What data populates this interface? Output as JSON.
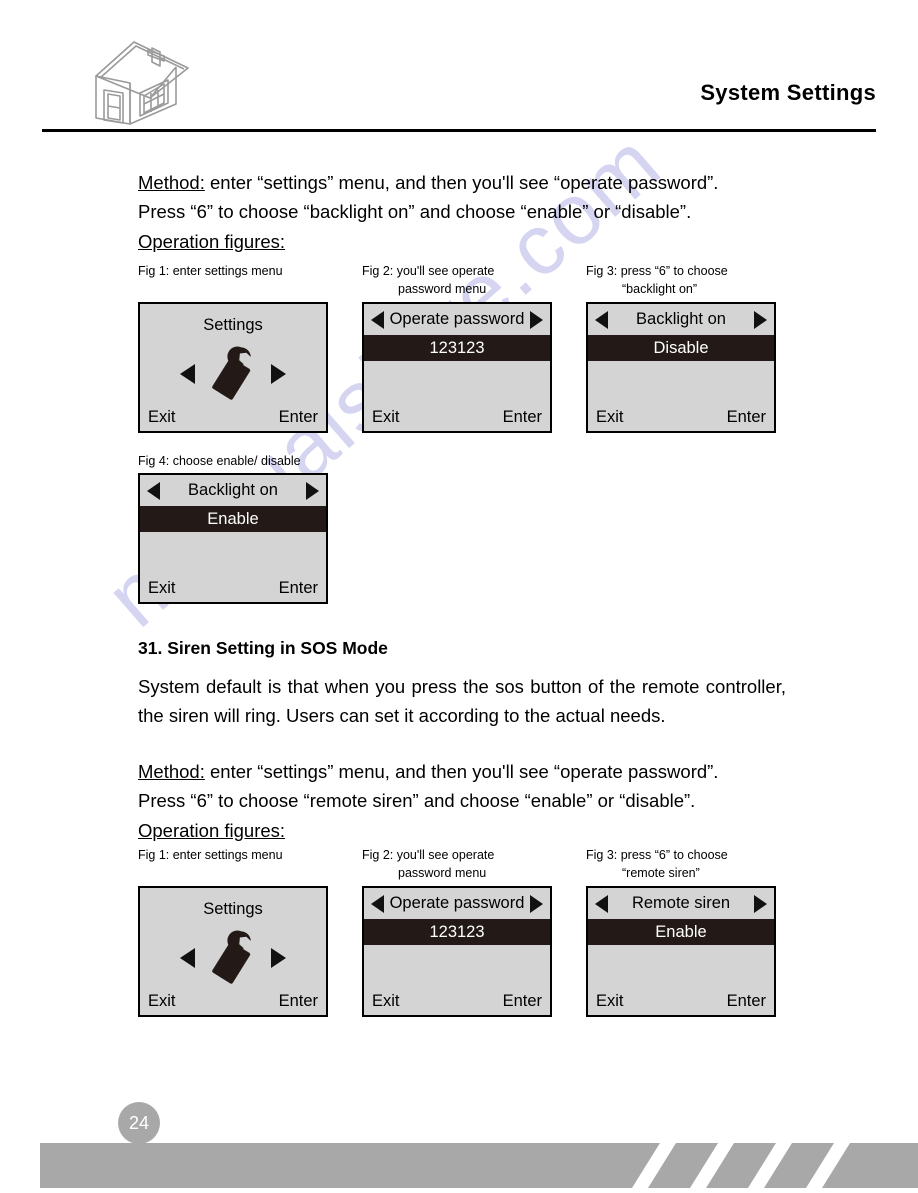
{
  "header": {
    "title": "System Settings",
    "logo_icon": "house-icon"
  },
  "watermark": {
    "text": "manualshive.com",
    "color": "#d5d5f2"
  },
  "sections": [
    {
      "method_line1_label": "Method:",
      "method_line1_rest": " enter “settings” menu, and then you'll see “operate password”.",
      "method_line2": "Press “6” to choose “backlight on” and choose “enable” or “disable”.",
      "operation_figures_label": "Operation figures:"
    },
    {
      "heading": "31. Siren Setting in SOS Mode",
      "body": "System default is that when you press the sos button of the remote controller, the siren will ring. Users can set it according to the actual needs.",
      "method_line1_label": "Method:",
      "method_line1_rest": " enter “settings” menu, and then you'll see “operate password”.",
      "method_line2": "Press “6” to choose “remote siren” and choose “enable” or “disable”.",
      "operation_figures_label": "Operation figures:"
    }
  ],
  "figures_group1": {
    "fig1": {
      "caption_line1": "Fig 1: enter settings menu",
      "caption_line2": "",
      "type": "settings",
      "title": "Settings",
      "icon": "wrench-icon",
      "exit_label": "Exit",
      "enter_label": "Enter"
    },
    "fig2": {
      "caption_line1": "Fig 2: you'll see operate",
      "caption_line2": "password menu",
      "type": "menu",
      "title": "Operate password",
      "highlight": "123123",
      "exit_label": "Exit",
      "enter_label": "Enter"
    },
    "fig3": {
      "caption_line1": "Fig 3: press “6” to choose",
      "caption_line2": "“backlight on”",
      "type": "menu",
      "title": "Backlight on",
      "highlight": "Disable",
      "exit_label": "Exit",
      "enter_label": "Enter"
    },
    "fig4": {
      "caption_line1": "Fig 4: choose enable/ disable",
      "caption_line2": "",
      "type": "menu",
      "title": "Backlight on",
      "highlight": "Enable",
      "exit_label": "Exit",
      "enter_label": "Enter"
    }
  },
  "figures_group2": {
    "fig1": {
      "caption_line1": "Fig 1: enter settings menu",
      "caption_line2": "",
      "type": "settings",
      "title": "Settings",
      "icon": "wrench-icon",
      "exit_label": "Exit",
      "enter_label": "Enter"
    },
    "fig2": {
      "caption_line1": "Fig 2: you'll see operate",
      "caption_line2": "password menu",
      "type": "menu",
      "title": "Operate password",
      "highlight": "123123",
      "exit_label": "Exit",
      "enter_label": "Enter"
    },
    "fig3": {
      "caption_line1": "Fig 3: press “6” to choose",
      "caption_line2": "“remote siren”",
      "type": "menu",
      "title": "Remote siren",
      "highlight": "Enable",
      "exit_label": "Exit",
      "enter_label": "Enter"
    }
  },
  "footer": {
    "page_number": "24",
    "bar_color": "#a8a8a8"
  }
}
